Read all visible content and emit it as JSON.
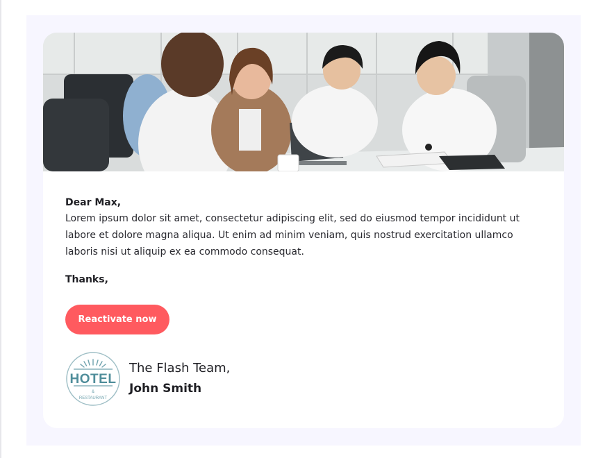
{
  "email": {
    "hero_image": "team-meeting-photo",
    "greeting": "Dear Max,",
    "body": "Lorem ipsum dolor sit amet, consectetur adipiscing elit, sed do eiusmod tempor incididunt ut labore et dolore magna aliqua. Ut enim ad minim veniam, quis nostrud exercitation ullamco laboris nisi ut aliquip ex ea commodo consequat.",
    "signoff": "Thanks,",
    "cta_label": "Reactivate now",
    "signature": {
      "team": "The Flash Team,",
      "name": "John Smith",
      "logo": {
        "icon": "hotel-restaurant-logo",
        "word": "HOTEL",
        "amp": "&",
        "sub": "RESTAURANT"
      }
    }
  },
  "colors": {
    "page_bg": "#ffffff",
    "outer_bg": "#f7f6ff",
    "card_bg": "#ffffff",
    "cta_bg": "#ff5a5f",
    "text": "#1f1f24",
    "logo_teal": "#4f8d9a"
  }
}
